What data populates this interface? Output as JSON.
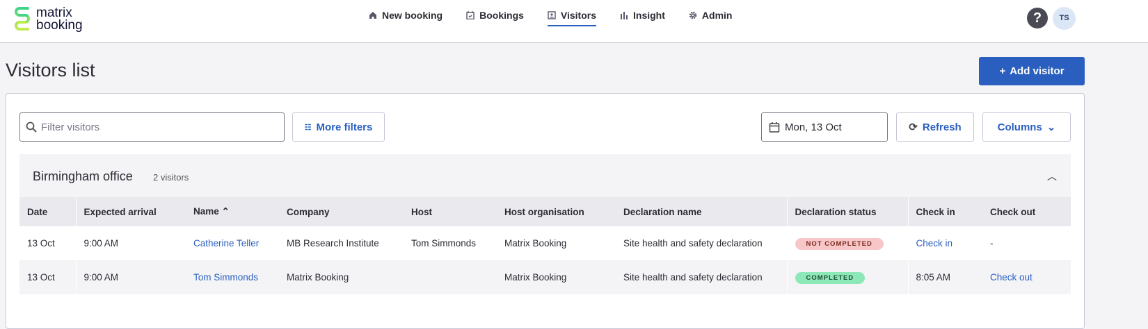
{
  "brand": {
    "line1": "matrix",
    "line2": "booking"
  },
  "nav": [
    {
      "label": "New booking",
      "icon": "home-icon"
    },
    {
      "label": "Bookings",
      "icon": "calendar-check-icon"
    },
    {
      "label": "Visitors",
      "icon": "badge-icon",
      "active": true
    },
    {
      "label": "Insight",
      "icon": "bar-chart-icon"
    },
    {
      "label": "Admin",
      "icon": "gear-icon"
    }
  ],
  "header": {
    "help": "?",
    "avatar": "TS"
  },
  "page": {
    "title": "Visitors list",
    "add_visitor": "Add visitor"
  },
  "toolbar": {
    "search_placeholder": "Filter visitors",
    "more_filters": "More filters",
    "date": "Mon, 13 Oct",
    "refresh": "Refresh",
    "columns": "Columns"
  },
  "group": {
    "title": "Birmingham office",
    "count": "2 visitors"
  },
  "columns": [
    "Date",
    "Expected arrival",
    "Name",
    "Company",
    "Host",
    "Host organisation",
    "Declaration name",
    "Declaration status",
    "Check in",
    "Check out"
  ],
  "rows": [
    {
      "date": "13 Oct",
      "arrival": "9:00 AM",
      "name": "Catherine Teller",
      "company": "MB Research Institute",
      "host": "Tom Simmonds",
      "host_org": "Matrix Booking",
      "declaration": "Site health and safety declaration",
      "status": "NOT COMPLETED",
      "check_in": "Check in",
      "check_out": "-"
    },
    {
      "date": "13 Oct",
      "arrival": "9:00 AM",
      "name": "Tom Simmonds",
      "company": "Matrix Booking",
      "host": "",
      "host_org": "Matrix Booking",
      "declaration": "Site health and safety declaration",
      "status": "COMPLETED",
      "check_in": "8:05 AM",
      "check_out": "Check out"
    }
  ]
}
